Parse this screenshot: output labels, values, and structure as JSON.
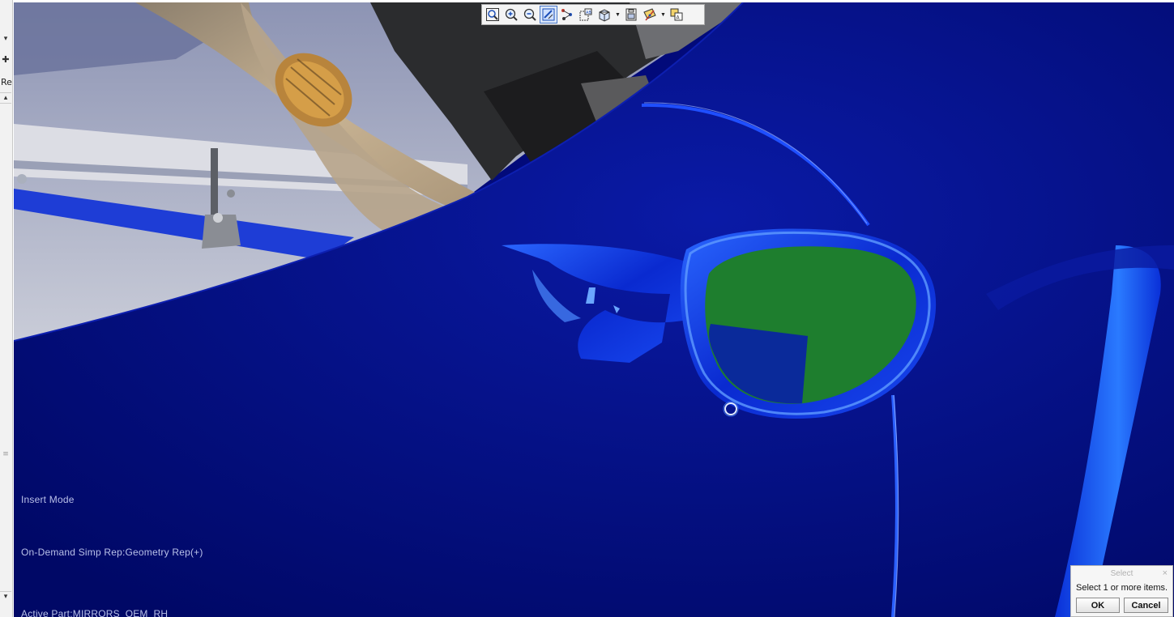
{
  "left_panel": {
    "dropdown_glyph": "▾",
    "add_glyph": "✚",
    "label_fragment": "Re",
    "scroll_up_glyph": "▴",
    "scroll_down_glyph": "▾",
    "grip_glyph": "≡"
  },
  "toolbar": {
    "items": [
      {
        "name": "refit-icon",
        "active": false
      },
      {
        "name": "zoom-in-icon",
        "active": false
      },
      {
        "name": "zoom-out-icon",
        "active": false
      },
      {
        "name": "repaint-icon",
        "active": true
      },
      {
        "name": "spin-center-icon",
        "active": false
      },
      {
        "name": "view-manager-icon",
        "active": false
      },
      {
        "name": "display-style-icon",
        "active": false,
        "dropdown": true
      },
      {
        "name": "saved-views-icon",
        "active": false
      },
      {
        "name": "datum-display-icon",
        "active": false,
        "dropdown": true
      },
      {
        "name": "annotation-display-icon",
        "active": false
      }
    ]
  },
  "viewport": {
    "status": {
      "mode": "Insert Mode",
      "simp_rep": "On-Demand Simp Rep:Geometry Rep(+)",
      "active_part": "Active Part:MIRRORS_OEM_RH"
    },
    "colors": {
      "background": "#020a7a",
      "highlight_green": "#1e7e2e",
      "preselect_blue": "#1b3aa0"
    }
  },
  "select_dialog": {
    "title": "Select",
    "close": "×",
    "prompt": "Select 1 or more items.",
    "ok_label": "OK",
    "cancel_label": "Cancel"
  }
}
